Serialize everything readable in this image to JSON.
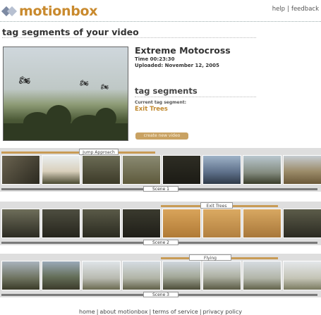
{
  "header": {
    "brand": "motionbox",
    "links": [
      "help",
      "feedback"
    ]
  },
  "page": {
    "title": "tag segments of your video"
  },
  "video": {
    "title": "Extreme Motocross",
    "time": "Time 00:23:30",
    "uploaded": "Uploaded: November 12, 2005"
  },
  "tags": {
    "heading": "tag segments",
    "current_label": "Current tag segment:",
    "current_value": "Exit Trees",
    "create_button": "create new video"
  },
  "strips": [
    {
      "tag_label": "Jump Approach",
      "scene_label": "Scene 1"
    },
    {
      "tag_label": "Exit Trees",
      "scene_label": "Scene 2"
    },
    {
      "tag_label": "Flying",
      "scene_label": "Scene 3"
    }
  ],
  "footer": {
    "links": [
      "home",
      "about motionbox",
      "terms of service",
      "privacy policy"
    ]
  },
  "colors": {
    "brand_orange": "#c98a2e",
    "tag_accent": "#c0892f",
    "button_bg": "#c9a263"
  }
}
